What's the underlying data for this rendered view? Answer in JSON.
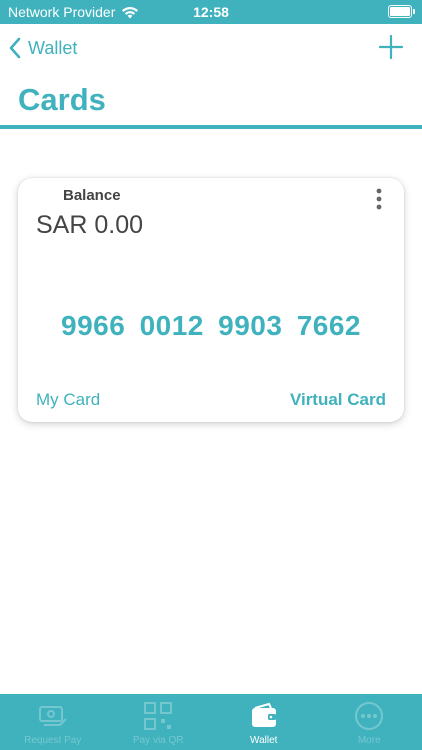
{
  "status_bar": {
    "carrier": "Network Provider",
    "time": "12:58"
  },
  "nav": {
    "back_label": "Wallet"
  },
  "page": {
    "title": "Cards"
  },
  "card": {
    "balance_label": "Balance",
    "balance_value": "SAR 0.00",
    "number": "9966 0012 9903 7662",
    "name": "My Card",
    "type": "Virtual Card"
  },
  "tab_bar": {
    "active_tab": "wallet",
    "tabs": [
      {
        "id": "request-pay",
        "label": "Request Pay",
        "icon": "send-money-icon"
      },
      {
        "id": "pay-qr",
        "label": "Pay via QR",
        "icon": "qr-code-icon"
      },
      {
        "id": "wallet",
        "label": "Wallet",
        "icon": "wallet-icon"
      },
      {
        "id": "more",
        "label": "More",
        "icon": "more-icon"
      }
    ]
  },
  "colors": {
    "accent": "#3fb2bd",
    "background": "#ffffff",
    "text_dark": "#444444"
  }
}
